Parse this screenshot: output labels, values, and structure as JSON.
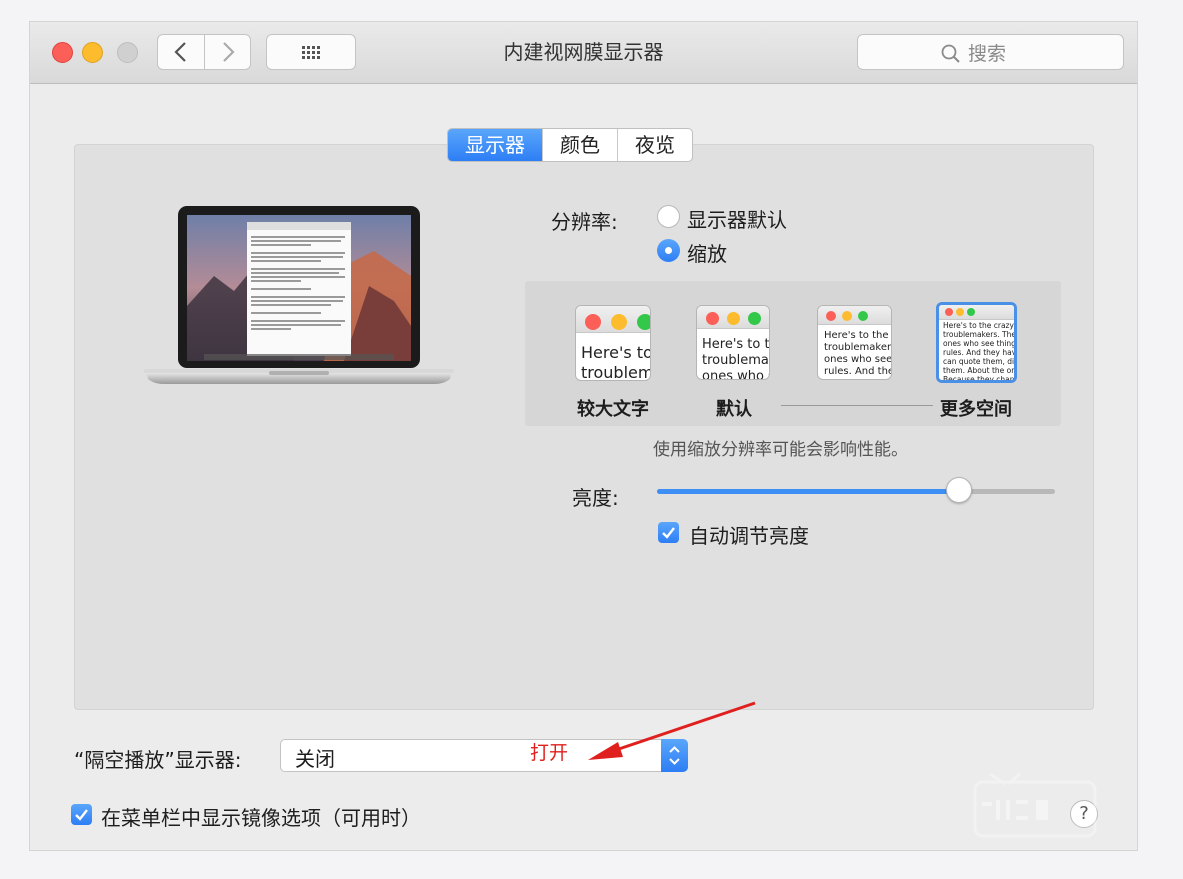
{
  "window": {
    "title": "内建视网膜显示器"
  },
  "search": {
    "placeholder": "搜索"
  },
  "tabs": [
    {
      "label": "显示器",
      "active": true
    },
    {
      "label": "颜色",
      "active": false
    },
    {
      "label": "夜览",
      "active": false
    }
  ],
  "resolution": {
    "label": "分辨率:",
    "options": [
      {
        "label": "显示器默认",
        "selected": false
      },
      {
        "label": "缩放",
        "selected": true
      }
    ]
  },
  "scaling": {
    "thumbnails": [
      {
        "text": [
          "Here's to",
          "troublem"
        ],
        "selected": false
      },
      {
        "text": [
          "Here's to th",
          "troublemak",
          "ones who s"
        ],
        "selected": false
      },
      {
        "text": [
          "Here's to the cr",
          "troublemakers.",
          "ones who see t",
          "rules. And they"
        ],
        "selected": false
      },
      {
        "text": [
          "Here's to the crazy one",
          "troublemakers. The rou",
          "ones who see things di",
          "rules. And they have no",
          "can quote them, disagr",
          "them. About the only th",
          "Because they change th"
        ],
        "selected": true
      }
    ],
    "labels": [
      "较大文字",
      "默认",
      "更多空间"
    ],
    "note": "使用缩放分辨率可能会影响性能。"
  },
  "brightness": {
    "label": "亮度:",
    "level": 0.76
  },
  "auto_brightness": {
    "label": "自动调节亮度",
    "checked": true
  },
  "airplay": {
    "label": "“隔空播放”显示器:",
    "value": "关闭",
    "annotation": "打开"
  },
  "mirror_option": {
    "label": "在菜单栏中显示镜像选项（可用时）",
    "checked": true
  },
  "help": {
    "symbol": "?"
  },
  "colors": {
    "accent": "#3d8ff6",
    "annotation": "#e0201e"
  },
  "icons": [
    "chevron-left-icon",
    "chevron-right-icon",
    "grid-icon",
    "search-icon",
    "checkmark-icon",
    "stepper-icon",
    "help-icon"
  ]
}
